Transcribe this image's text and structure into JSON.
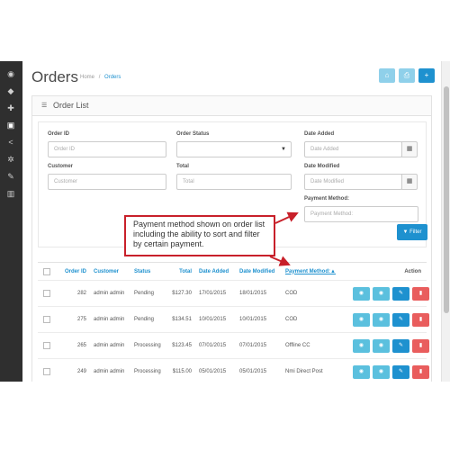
{
  "header": {
    "title": "Orders",
    "breadcrumb": [
      "Home",
      "/",
      "Orders"
    ]
  },
  "sidebar": {
    "icons": [
      "dashboard-icon",
      "tags-icon",
      "puzzle-icon",
      "cart-icon",
      "share-icon",
      "gear-icon",
      "wrench-icon",
      "bar-chart-icon"
    ]
  },
  "toolbar": {
    "buttons": [
      {
        "icon": "home-icon",
        "glyph": "⌂"
      },
      {
        "icon": "print-icon",
        "glyph": "⎙"
      },
      {
        "icon": "add-icon",
        "glyph": "+"
      }
    ]
  },
  "panel": {
    "title": "Order List",
    "icon": "list-icon"
  },
  "filter": {
    "order_id": {
      "label": "Order ID",
      "placeholder": "Order ID"
    },
    "order_status": {
      "label": "Order Status",
      "value": ""
    },
    "date_added": {
      "label": "Date Added",
      "placeholder": "Date Added"
    },
    "customer": {
      "label": "Customer",
      "placeholder": "Customer"
    },
    "total": {
      "label": "Total",
      "placeholder": "Total"
    },
    "date_modified": {
      "label": "Date Modified",
      "placeholder": "Date Modified"
    },
    "payment_method": {
      "label": "Payment Method:",
      "placeholder": "Payment Method:"
    },
    "filter_button": "Filter"
  },
  "table": {
    "columns": [
      "Order ID",
      "Customer",
      "Status",
      "Total",
      "Date Added",
      "Date Modified",
      "Payment Method:",
      "Action"
    ],
    "rows": [
      [
        "282",
        "admin admin",
        "Pending",
        "$127.30",
        "17/01/2015",
        "18/01/2015",
        "COD"
      ],
      [
        "275",
        "admin admin",
        "Pending",
        "$134.51",
        "10/01/2015",
        "10/01/2015",
        "COD"
      ],
      [
        "265",
        "admin admin",
        "Processing",
        "$123.45",
        "07/01/2015",
        "07/01/2015",
        "Offline CC"
      ],
      [
        "249",
        "admin admin",
        "Processing",
        "$115.00",
        "05/01/2015",
        "05/01/2015",
        "Nmi Direct Post"
      ]
    ]
  },
  "callout": {
    "text": "Payment method shown on order list including the ability to sort and filter by certain payment."
  },
  "colors": {
    "primary": "#1e91cf",
    "info": "#5bc0de",
    "danger": "#e95d5d",
    "sidebar": "#2f2f2f",
    "callout_border": "#c8202a"
  }
}
